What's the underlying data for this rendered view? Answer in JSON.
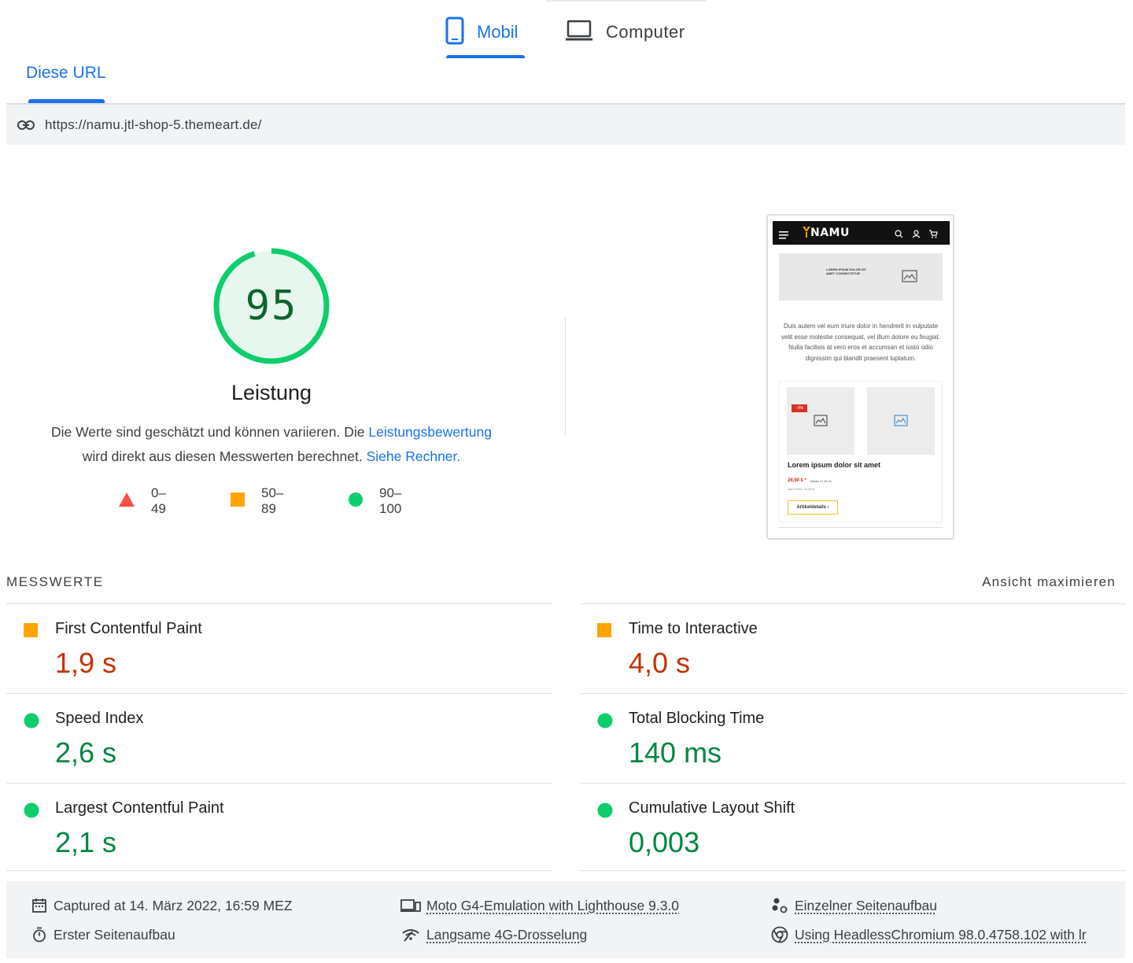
{
  "device_tabs": [
    {
      "label": "Mobil",
      "icon": "phone-icon",
      "selected": true
    },
    {
      "label": "Computer",
      "icon": "laptop-icon",
      "selected": false
    }
  ],
  "url_tab": {
    "label": "Diese URL"
  },
  "url_bar": {
    "icon": "link-icon",
    "url": "https://namu.jtl-shop-5.themeart.de/"
  },
  "gauge": {
    "score": "95",
    "score_fraction": 0.95,
    "title": "Leistung",
    "desc_part1": "Die Werte sind geschätzt und können variieren. Die ",
    "desc_link1": "Leistungsbewertung",
    "desc_part2": " wird direkt aus diesen Messwerten berechnet. ",
    "desc_link2": "Siehe Rechner.",
    "color": "#0cce6b"
  },
  "legend": [
    {
      "label": "0–49",
      "shape": "triangle",
      "color": "#ff4e42"
    },
    {
      "label": "50–89",
      "shape": "square",
      "color": "#ffa400"
    },
    {
      "label": "90–100",
      "shape": "circle",
      "color": "#0cce6b"
    }
  ],
  "thumbnail": {
    "logo": "NAMU",
    "banner_text": "Lorem ipsum dolor sit amet consectetur",
    "paragraph": "Duis autem vel eum iriure dolor in hendrerit in vulputate velit esse molestie consequat, vel illum dolore eu feugiat. Nulla facilisis at vero eros et accumsan et iusto odio dignissim qui blandit praesent luptatum.",
    "badge": "- 8%",
    "product_name": "Lorem ipsum dolor sit amet",
    "price": "26,90 € *",
    "net_price": "(Netto 21,81 €)",
    "old_price": "Alter Preis: 29,00 €",
    "button": "Artikeldetails ›"
  },
  "metrics": {
    "title": "MESSWERTE",
    "toggle": "Ansicht maximieren",
    "items": [
      {
        "label": "First Contentful Paint",
        "value": "1,9 s",
        "rating": "average"
      },
      {
        "label": "Time to Interactive",
        "value": "4,0 s",
        "rating": "average"
      },
      {
        "label": "Speed Index",
        "value": "2,6 s",
        "rating": "pass"
      },
      {
        "label": "Total Blocking Time",
        "value": "140 ms",
        "rating": "pass"
      },
      {
        "label": "Largest Contentful Paint",
        "value": "2,1 s",
        "rating": "pass"
      },
      {
        "label": "Cumulative Layout Shift",
        "value": "0,003",
        "rating": "pass"
      }
    ],
    "colors": {
      "average": "#ffa400",
      "pass": "#0cce6b",
      "average_text": "#c33300",
      "pass_text": "#018642"
    }
  },
  "footer": {
    "captured": "Captured at 14. März 2022, 16:59 MEZ",
    "first_load": "Erster Seitenaufbau",
    "emulation": "Moto G4-Emulation with Lighthouse 9.3.0",
    "throttling": "Langsame 4G-Drosselung",
    "single_load": "Einzelner Seitenaufbau",
    "browser": "Using HeadlessChromium 98.0.4758.102 with lr"
  }
}
